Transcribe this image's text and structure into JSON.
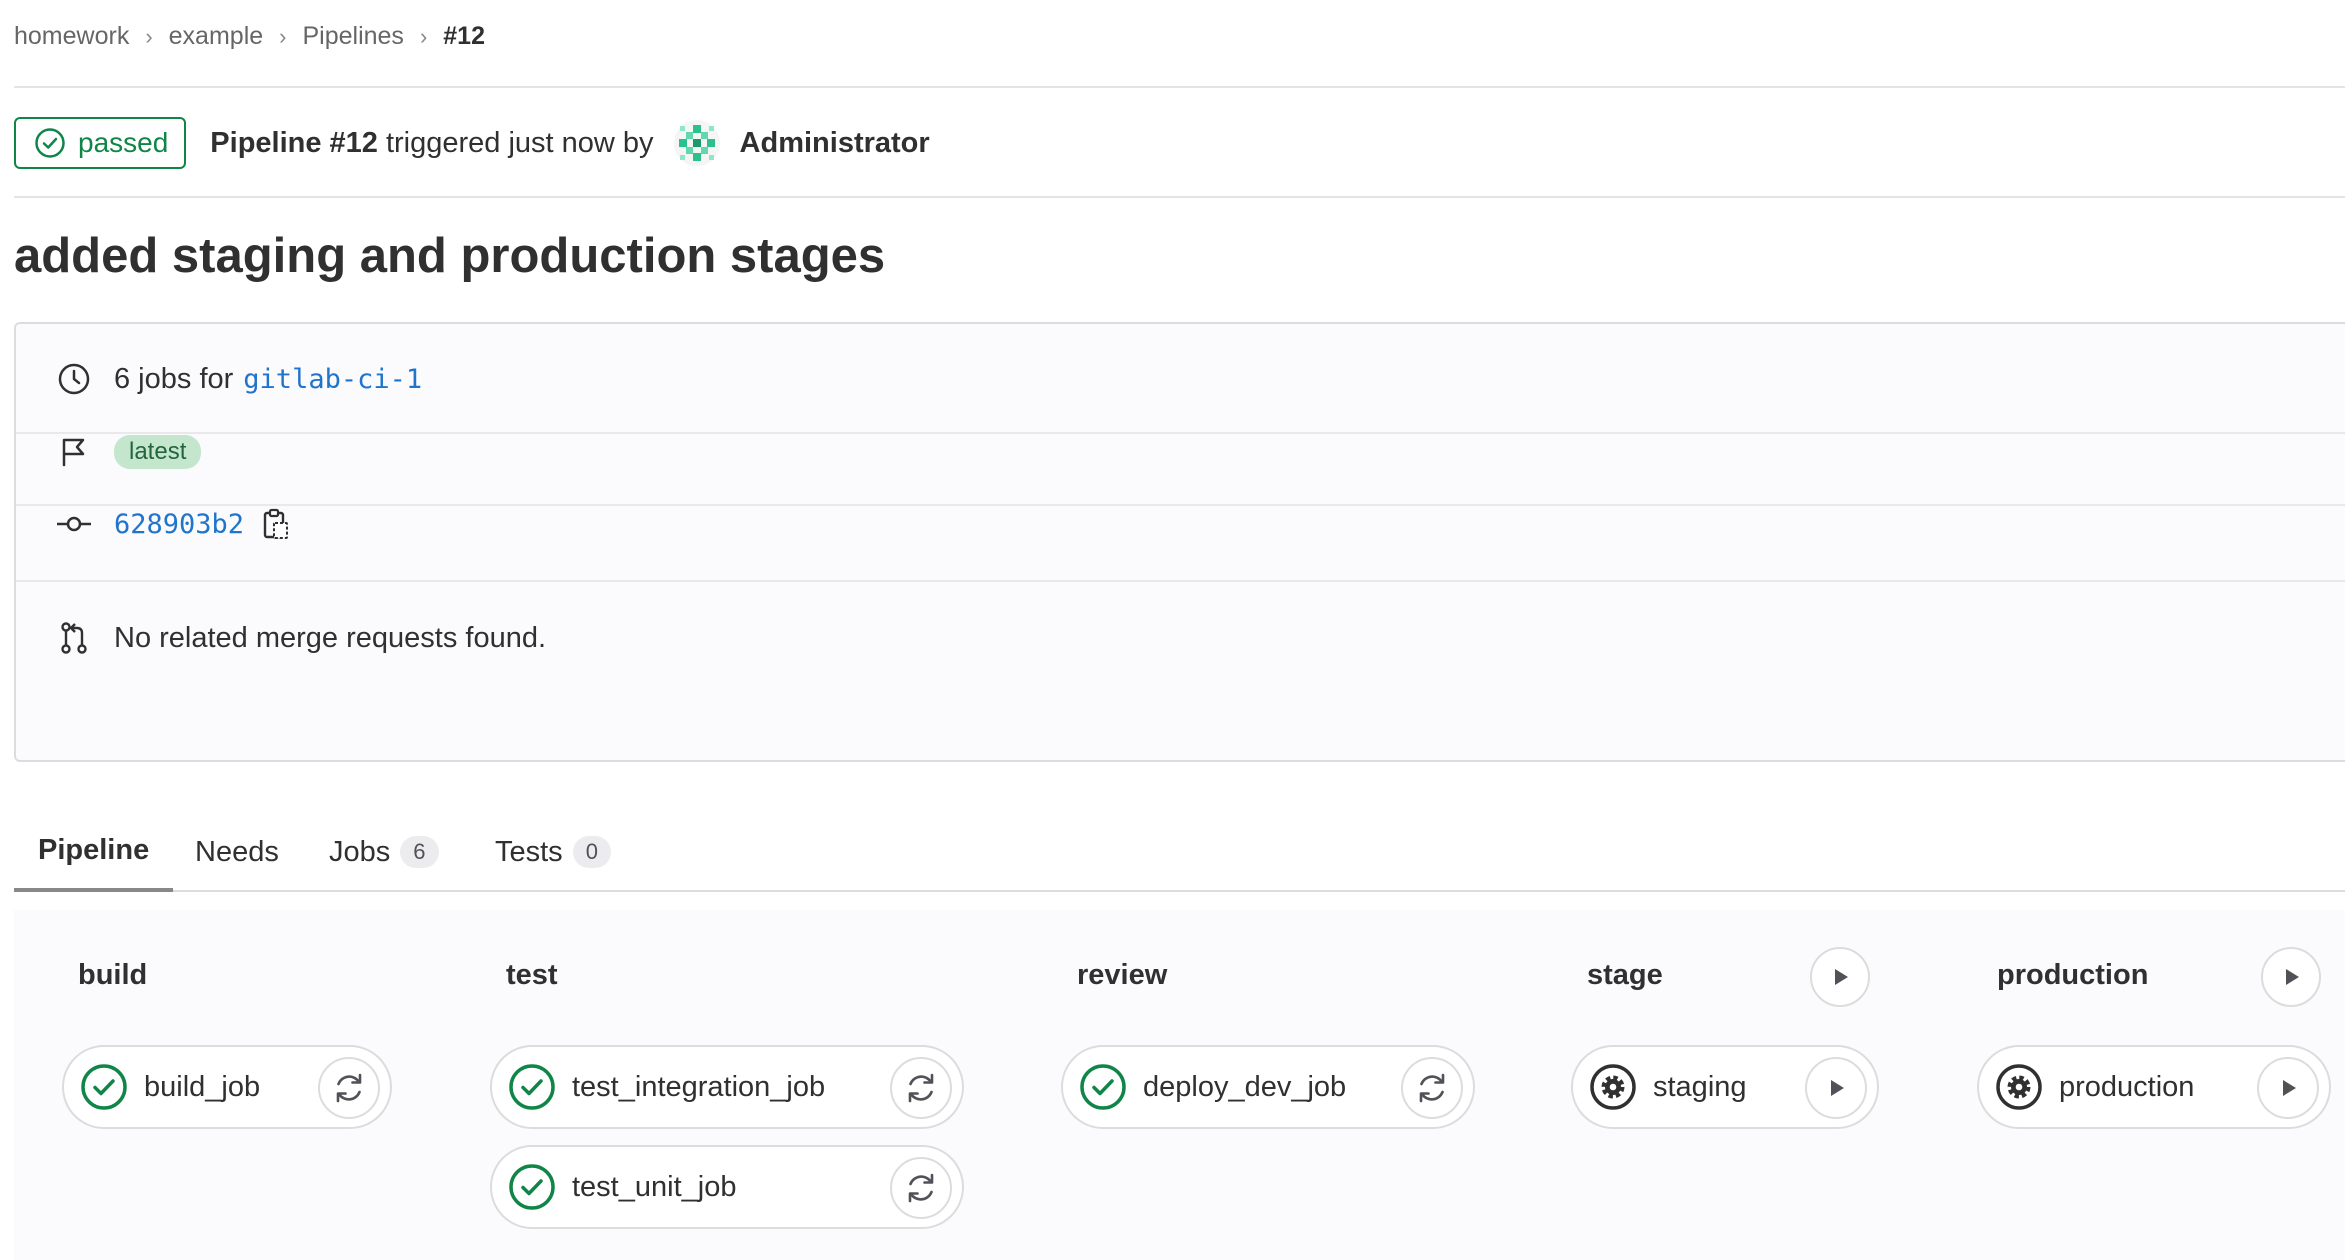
{
  "breadcrumb": {
    "items": [
      "homework",
      "example",
      "Pipelines"
    ],
    "current": "#12",
    "separator": "›"
  },
  "header": {
    "status": "passed",
    "pipeline_label": "Pipeline #12",
    "triggered_text": "triggered just now by",
    "author": "Administrator"
  },
  "title": "added staging and production stages",
  "info": {
    "jobs_text": "6 jobs for",
    "branch": "gitlab-ci-1",
    "badge": "latest",
    "commit_sha": "628903b2",
    "merge_requests": "No related merge requests found."
  },
  "tabs": [
    {
      "label": "Pipeline",
      "active": true
    },
    {
      "label": "Needs"
    },
    {
      "label": "Jobs",
      "count": "6"
    },
    {
      "label": "Tests",
      "count": "0"
    }
  ],
  "stages": [
    {
      "name": "build",
      "jobs": [
        {
          "name": "build_job",
          "status": "success",
          "action": "retry"
        }
      ]
    },
    {
      "name": "test",
      "jobs": [
        {
          "name": "test_integration_job",
          "status": "success",
          "action": "retry"
        },
        {
          "name": "test_unit_job",
          "status": "success",
          "action": "retry"
        }
      ]
    },
    {
      "name": "review",
      "jobs": [
        {
          "name": "deploy_dev_job",
          "status": "success",
          "action": "retry"
        }
      ]
    },
    {
      "name": "stage",
      "stage_action": "play",
      "jobs": [
        {
          "name": "staging",
          "status": "manual",
          "action": "play"
        }
      ]
    },
    {
      "name": "production",
      "stage_action": "play",
      "jobs": [
        {
          "name": "production",
          "status": "manual",
          "action": "play"
        }
      ]
    }
  ],
  "colors": {
    "success": "#108548",
    "link": "#1f75cb",
    "badge_bg": "#c3e6cd",
    "text": "#303030"
  }
}
